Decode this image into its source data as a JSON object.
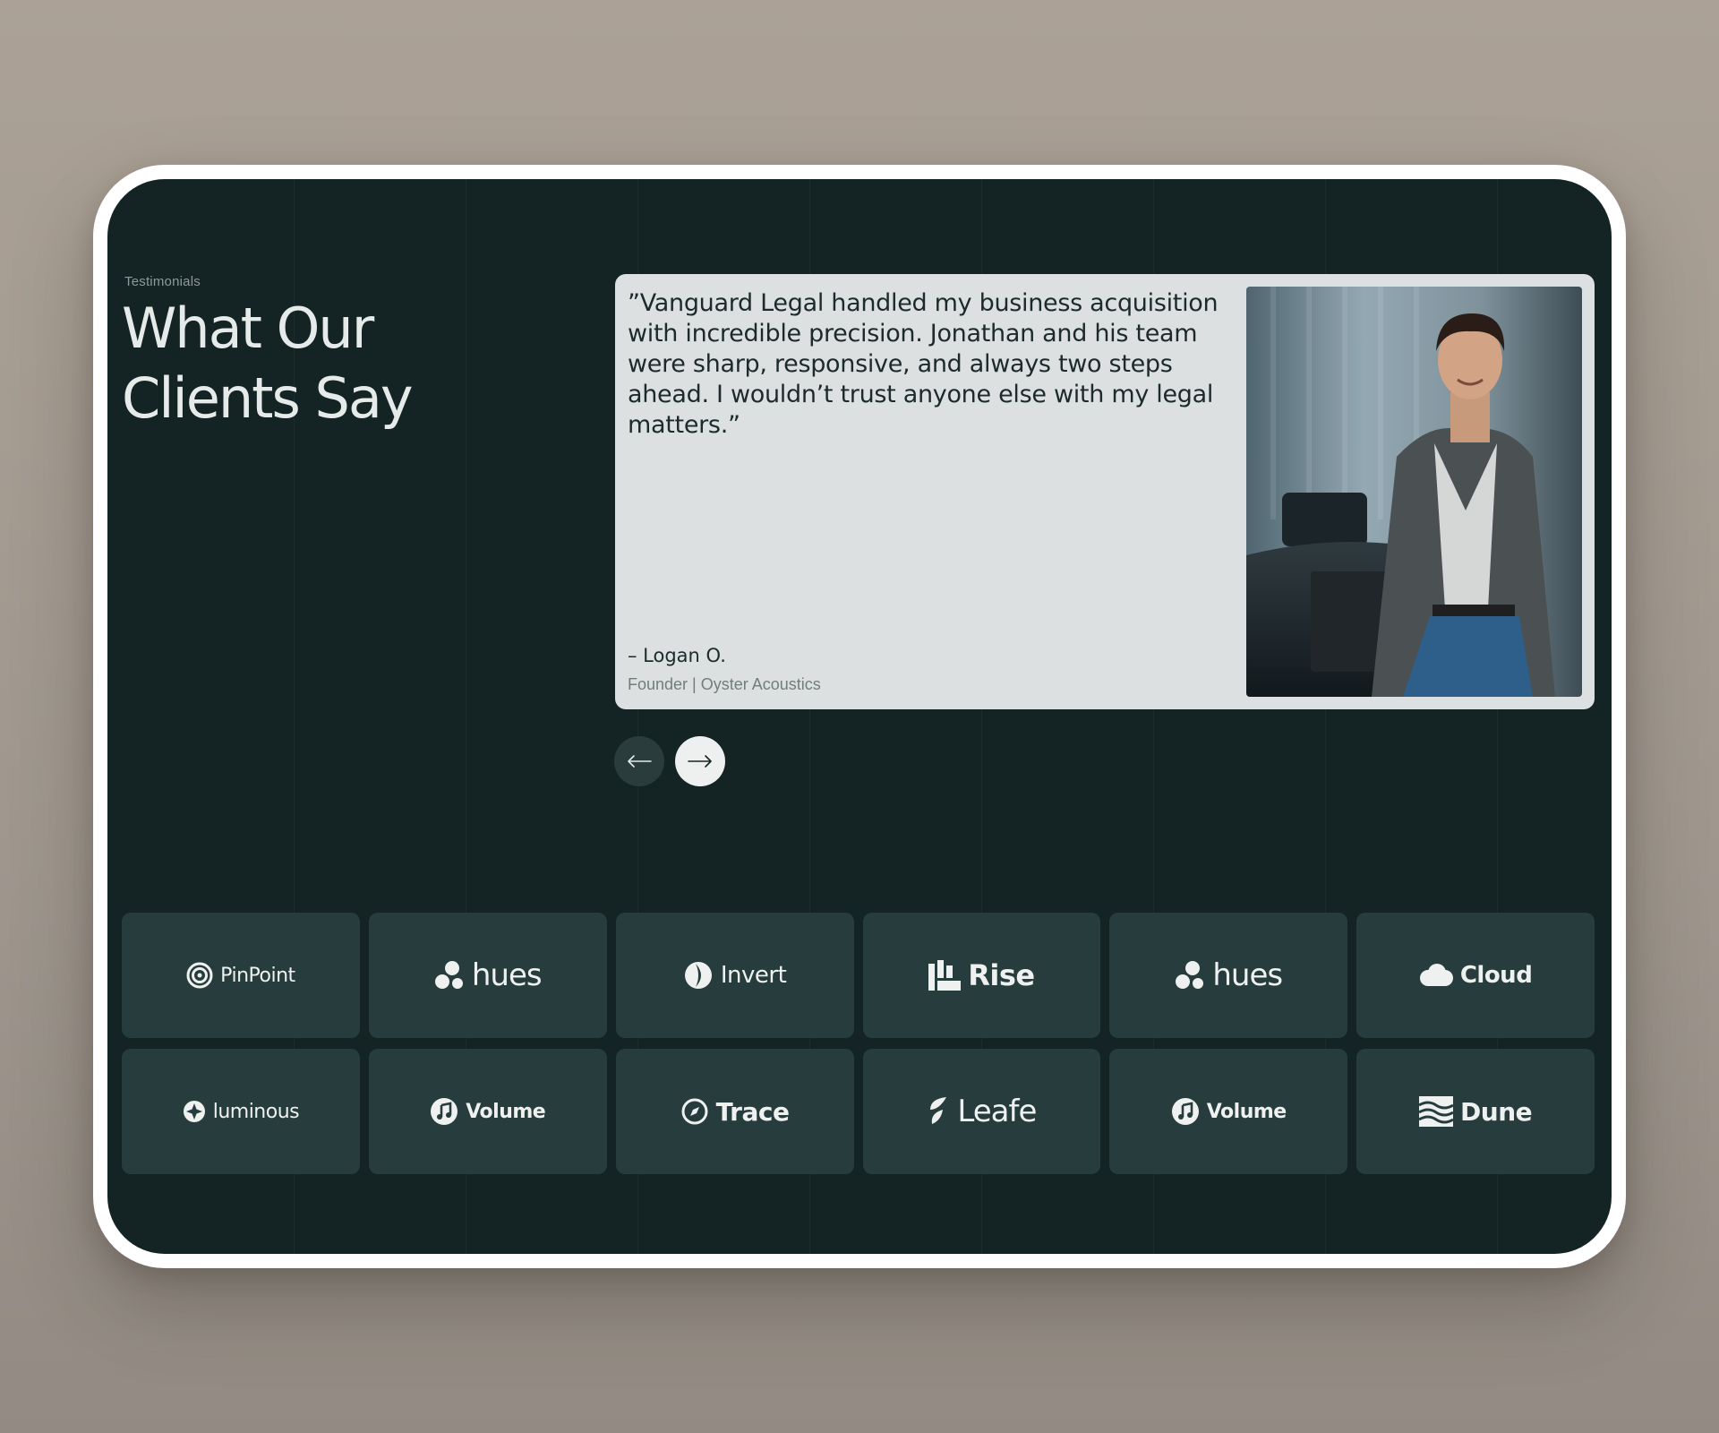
{
  "section": {
    "eyebrow": "Testimonials",
    "headline_line1": "What Our",
    "headline_line2": "Clients Say"
  },
  "testimonial": {
    "quote": "”Vanguard Legal handled my business acquisition with incredible precision. Jonathan and his team were sharp, responsive, and always two steps ahead. I wouldn’t trust anyone else with my legal matters.”",
    "author": "– Logan O.",
    "role": "Founder | Oyster Acoustics",
    "photo_icon": "portrait-photo"
  },
  "navigation": {
    "prev_icon": "arrow-left-icon",
    "next_icon": "arrow-right-icon"
  },
  "logos": [
    {
      "name": "PinPoint",
      "icon": "target-icon"
    },
    {
      "name": "hues",
      "icon": "blob-icon"
    },
    {
      "name": "Invert",
      "icon": "crescent-icon"
    },
    {
      "name": "Rise",
      "icon": "bars-icon"
    },
    {
      "name": "hues",
      "icon": "blob-icon"
    },
    {
      "name": "Cloud",
      "icon": "cloud-icon"
    },
    {
      "name": "luminous",
      "icon": "star-badge-icon"
    },
    {
      "name": "Volume",
      "icon": "music-note-icon"
    },
    {
      "name": "Trace",
      "icon": "compass-icon"
    },
    {
      "name": "Leafe",
      "icon": "leaf-icon"
    },
    {
      "name": "Volume",
      "icon": "music-note-icon"
    },
    {
      "name": "Dune",
      "icon": "waves-icon"
    }
  ],
  "colors": {
    "page_bg": "#a59d94",
    "screen_bg": "#142425",
    "card_bg": "#dce0e1",
    "tile_bg": "#273c3c",
    "text_light": "#e6ebe9"
  }
}
